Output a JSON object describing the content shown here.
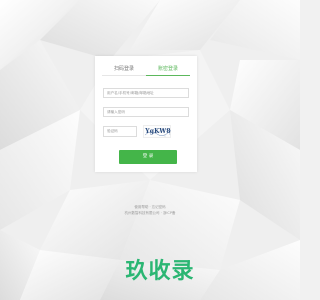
{
  "tabs": [
    {
      "label": "扫码登录"
    },
    {
      "label": "账密登录"
    }
  ],
  "login_form": {
    "username_placeholder": "用户名/手机号/邮箱/邮箱地址",
    "password_placeholder": "请输入密码",
    "captcha_placeholder": "验证码",
    "captcha_text": "YgKW8",
    "login_label": "登 录"
  },
  "footer": {
    "line1": "使用帮助 · 忘记密码",
    "line2": "杭州数智科技有限公司 · 浙ICP备"
  },
  "watermark": {
    "text": "玖收录"
  },
  "colors": {
    "accent_green": "#44b549",
    "watermark_green": "#2bb673",
    "background": "#f1f1f1"
  }
}
